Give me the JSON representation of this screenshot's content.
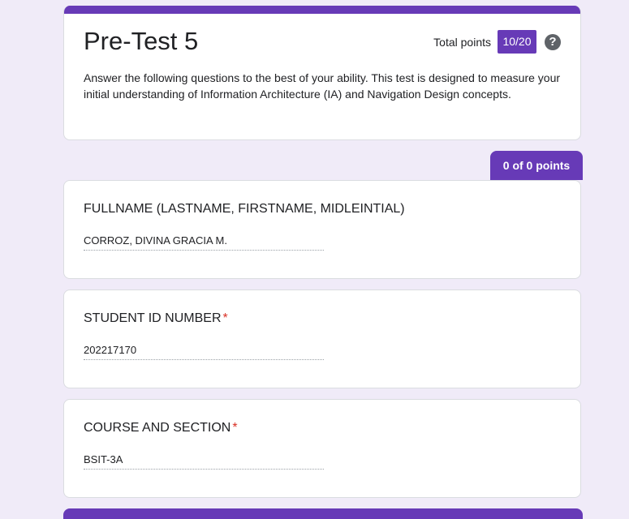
{
  "form": {
    "title": "Pre-Test 5",
    "total_points_label": "Total points",
    "score": "10/20",
    "help_icon": "help-circle-icon",
    "description": "Answer the following questions to the best of your ability. This test is designed to measure your initial understanding of Information Architecture (IA) and Navigation Design concepts."
  },
  "section": {
    "points": "0 of 0 points"
  },
  "questions": [
    {
      "title": "FULLNAME (LASTNAME, FIRSTNAME, MIDLEINTIAL)",
      "required": "",
      "answer": "CORROZ, DIVINA GRACIA M."
    },
    {
      "title": "STUDENT ID NUMBER",
      "required": "*",
      "answer": "202217170"
    },
    {
      "title": "COURSE AND SECTION",
      "required": "*",
      "answer": "BSIT-3A"
    }
  ],
  "colors": {
    "accent": "#673ab7",
    "background": "#f0ebf8",
    "required": "#d93025"
  }
}
